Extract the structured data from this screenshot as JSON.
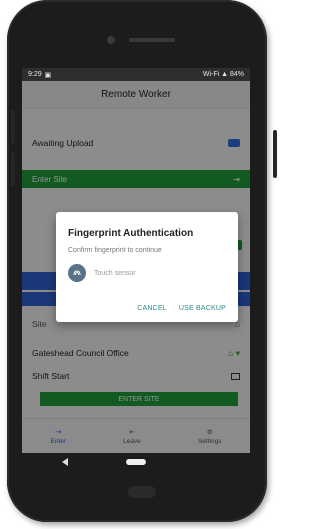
{
  "status_bar": {
    "time": "9:29",
    "right_text": "Wi-Fi ▲ 84%"
  },
  "app_bar": {
    "title": "Remote Worker"
  },
  "pending": {
    "label": "Awaiting Upload"
  },
  "enter_site_header": {
    "label": "Enter Site"
  },
  "site_row": {
    "label": "Site"
  },
  "office_row": {
    "label": "Gateshead Council Office"
  },
  "shift_row": {
    "label": "Shift Start"
  },
  "enter_site_button": {
    "label": "ENTER SITE"
  },
  "bottom_nav": {
    "items": [
      {
        "label": "Enter"
      },
      {
        "label": "Leave"
      },
      {
        "label": "Settings"
      }
    ]
  },
  "dialog": {
    "title": "Fingerprint Authentication",
    "subtitle": "Confirm fingerprint to continue",
    "touch_hint": "Touch sensor",
    "cancel_label": "CANCEL",
    "backup_label": "USE BACKUP"
  },
  "colors": {
    "accent_green": "#1f9b3b",
    "accent_blue": "#2d6bd9",
    "dialog_action": "#2d8a8a"
  }
}
